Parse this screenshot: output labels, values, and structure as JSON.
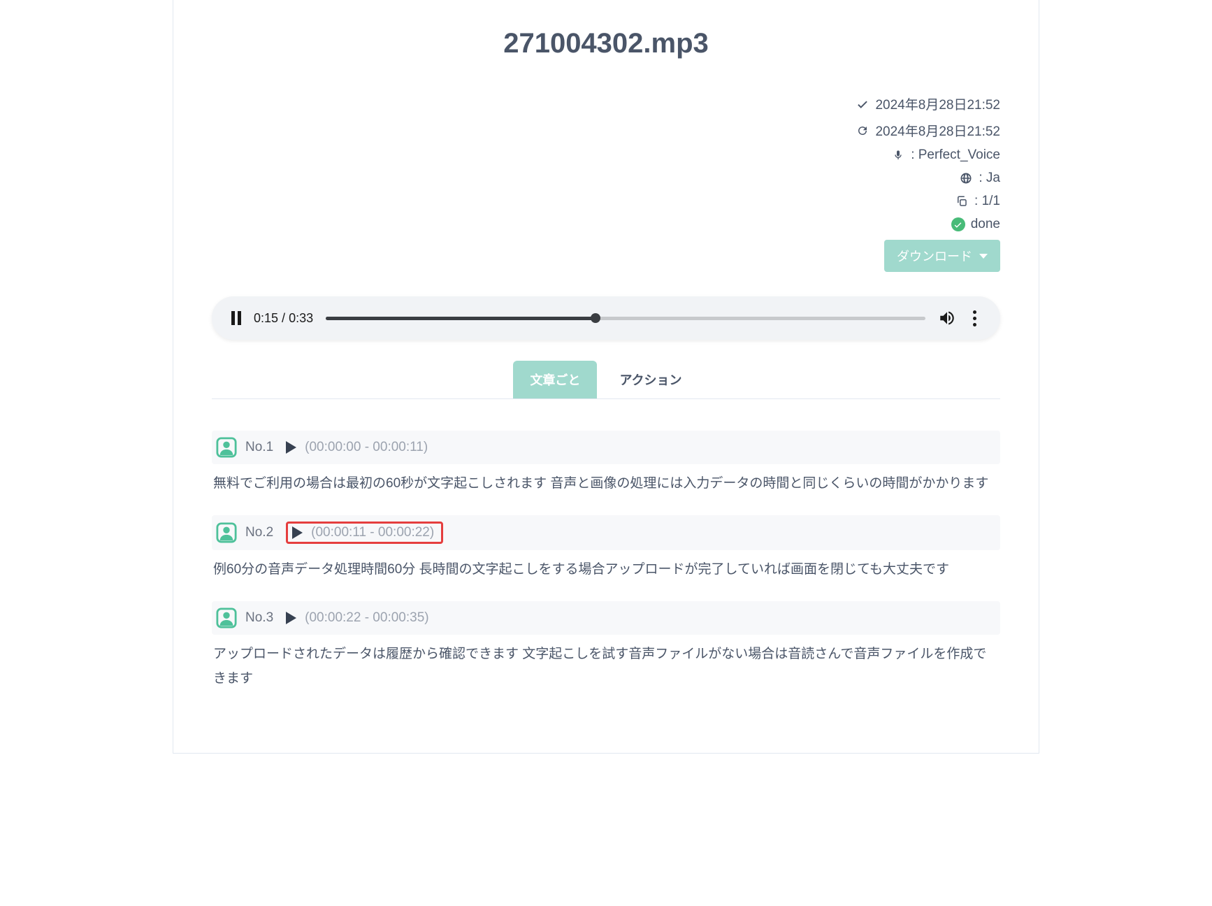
{
  "title": "271004302.mp3",
  "meta": {
    "created": "2024年8月28日21:52",
    "updated": "2024年8月28日21:52",
    "model_label": ": Perfect_Voice",
    "language_label": ": Ja",
    "pages_label": ": 1/1",
    "status": "done"
  },
  "download_label": "ダウンロード",
  "player": {
    "current": "0:15",
    "total": "0:33"
  },
  "tabs": {
    "by_sentence": "文章ごと",
    "action": "アクション"
  },
  "segments": [
    {
      "no": "No.1",
      "time": "(00:00:00 - 00:00:11)",
      "text": "無料でご利用の場合は最初の60秒が文字起こしされます 音声と画像の処理には入力データの時間と同じくらいの時間がかかります",
      "highlighted": false
    },
    {
      "no": "No.2",
      "time": "(00:00:11 - 00:00:22)",
      "text": "例60分の音声データ処理時間60分 長時間の文字起こしをする場合アップロードが完了していれば画面を閉じても大丈夫です",
      "highlighted": true
    },
    {
      "no": "No.3",
      "time": "(00:00:22 - 00:00:35)",
      "text": "アップロードされたデータは履歴から確認できます 文字起こしを試す音声ファイルがない場合は音読さんで音声ファイルを作成できます",
      "highlighted": false
    }
  ]
}
